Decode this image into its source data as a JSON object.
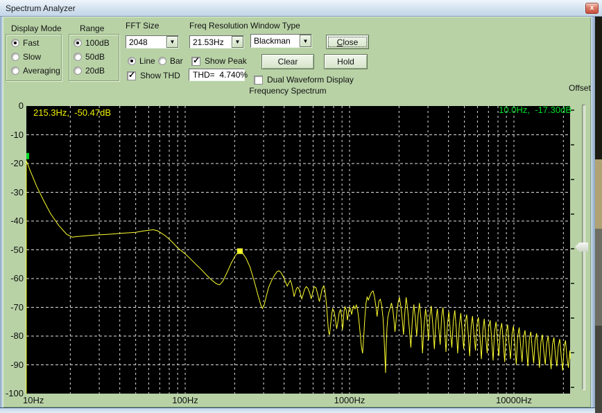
{
  "window": {
    "title": "Spectrum Analyzer",
    "close_glyph": "x"
  },
  "panel": {
    "display_mode": {
      "label": "Display Mode",
      "options": [
        {
          "label": "Fast",
          "selected": true
        },
        {
          "label": "Slow",
          "selected": false
        },
        {
          "label": "Averaging",
          "selected": false
        }
      ]
    },
    "range": {
      "label": "Range",
      "options": [
        {
          "label": "100dB",
          "selected": true
        },
        {
          "label": "50dB",
          "selected": false
        },
        {
          "label": "20dB",
          "selected": false
        }
      ]
    },
    "fft_size": {
      "label": "FFT Size",
      "value": "2048"
    },
    "freq_resolution": {
      "label": "Freq Resolution",
      "value": "21.53Hz"
    },
    "window_type": {
      "label": "Window Type",
      "value": "Blackman"
    },
    "line_bar": {
      "options": [
        {
          "label": "Line",
          "selected": true
        },
        {
          "label": "Bar",
          "selected": false
        }
      ]
    },
    "show_thd": {
      "label": "Show THD",
      "checked": true
    },
    "show_peak": {
      "label": "Show Peak",
      "checked": true
    },
    "thd_readout": "THD=  4.740%",
    "buttons": {
      "close": "Close",
      "clear": "Clear",
      "hold": "Hold"
    },
    "dual_waveform": {
      "label": "Dual Waveform Display",
      "checked": false
    },
    "offset_label": "Offset"
  },
  "chart_data": {
    "type": "line",
    "title": "Frequency Spectrum",
    "x_scale": "log",
    "x_range_hz": [
      10.8,
      22050
    ],
    "y_range_db": [
      -100,
      0
    ],
    "grid": true,
    "bg_color": "#000000",
    "grid_color": "#e2e2e2",
    "trace_color": "#ffff2e",
    "peak_marker_color": "#ffff2e",
    "cursor_marker_color": "#00dc28",
    "y_tick_labels": [
      "0",
      "-10",
      "-20",
      "-30",
      "-40",
      "-50",
      "-60",
      "-70",
      "-80",
      "-90",
      "-100"
    ],
    "x_ticks": [
      {
        "hz": 10,
        "label": "10Hz"
      },
      {
        "hz": 100,
        "label": "100Hz"
      },
      {
        "hz": 1000,
        "label": "1000Hz"
      },
      {
        "hz": 10000,
        "label": "10000Hz"
      }
    ],
    "peak_readout": "215.3Hz,  -50.47dB",
    "cursor_readout": "10.0Hz,  -17.30dB",
    "peak_marker": {
      "hz": 215.3,
      "db": -50.47
    },
    "cursor_marker": {
      "hz": 10.8,
      "db": -17.3
    },
    "points": [
      [
        10.8,
        -100
      ],
      [
        10.8,
        -19
      ],
      [
        11.5,
        -23
      ],
      [
        12.5,
        -28
      ],
      [
        13.8,
        -33
      ],
      [
        15.2,
        -37.5
      ],
      [
        17,
        -41.5
      ],
      [
        19,
        -44.6
      ],
      [
        20.5,
        -45.6
      ],
      [
        22,
        -45.4
      ],
      [
        25,
        -45.1
      ],
      [
        28,
        -44.9
      ],
      [
        32,
        -44.7
      ],
      [
        36,
        -44.5
      ],
      [
        40,
        -44.3
      ],
      [
        45,
        -44.1
      ],
      [
        50,
        -43.9
      ],
      [
        55,
        -43.5
      ],
      [
        60,
        -43.2
      ],
      [
        64,
        -43
      ],
      [
        68,
        -43.4
      ],
      [
        72,
        -44.3
      ],
      [
        76,
        -45.2
      ],
      [
        80,
        -46.3
      ],
      [
        85,
        -47.8
      ],
      [
        90,
        -49.3
      ],
      [
        95,
        -50.4
      ],
      [
        100,
        -51.4
      ],
      [
        108,
        -53.2
      ],
      [
        116,
        -55
      ],
      [
        125,
        -56.8
      ],
      [
        135,
        -58.8
      ],
      [
        145,
        -60.5
      ],
      [
        155,
        -61.8
      ],
      [
        162,
        -62.2
      ],
      [
        170,
        -60.8
      ],
      [
        180,
        -57.8
      ],
      [
        190,
        -54.8
      ],
      [
        200,
        -52.4
      ],
      [
        208,
        -51.1
      ],
      [
        215.3,
        -50.47
      ],
      [
        224,
        -51.2
      ],
      [
        235,
        -53
      ],
      [
        248,
        -56
      ],
      [
        262,
        -60.5
      ],
      [
        275,
        -65
      ],
      [
        288,
        -69
      ],
      [
        295,
        -70.4
      ],
      [
        302,
        -69.2
      ],
      [
        312,
        -66
      ],
      [
        322,
        -63
      ],
      [
        335,
        -60.8
      ],
      [
        350,
        -58.8
      ],
      [
        362,
        -57.6
      ],
      [
        372,
        -57.3
      ],
      [
        382,
        -57.8
      ],
      [
        395,
        -59.3
      ],
      [
        408,
        -61.2
      ],
      [
        418,
        -62.6
      ],
      [
        428,
        -61.4
      ],
      [
        436,
        -60.6
      ],
      [
        444,
        -61.8
      ],
      [
        452,
        -64
      ],
      [
        460,
        -66.3
      ],
      [
        468,
        -64.8
      ],
      [
        476,
        -63.4
      ],
      [
        484,
        -63
      ],
      [
        492,
        -63.6
      ],
      [
        502,
        -65.2
      ],
      [
        512,
        -67
      ],
      [
        522,
        -65.5
      ],
      [
        532,
        -63.8
      ],
      [
        545,
        -62.8
      ],
      [
        558,
        -63.4
      ],
      [
        572,
        -65
      ],
      [
        585,
        -67
      ],
      [
        598,
        -64.5
      ],
      [
        610,
        -62.8
      ],
      [
        625,
        -63.2
      ],
      [
        640,
        -65.5
      ],
      [
        655,
        -68
      ],
      [
        668,
        -66
      ],
      [
        680,
        -63.8
      ],
      [
        695,
        -62.6
      ],
      [
        705,
        -63.5
      ],
      [
        715,
        -66
      ],
      [
        725,
        -69.5
      ],
      [
        735,
        -74
      ],
      [
        745,
        -78.5
      ],
      [
        755,
        -79.6
      ],
      [
        765,
        -76.5
      ],
      [
        778,
        -72.5
      ],
      [
        790,
        -70.5
      ],
      [
        805,
        -71.5
      ],
      [
        820,
        -74
      ],
      [
        835,
        -77.5
      ],
      [
        850,
        -75
      ],
      [
        865,
        -71.8
      ],
      [
        880,
        -70.8
      ],
      [
        895,
        -73
      ],
      [
        905,
        -77.8
      ],
      [
        915,
        -75.5
      ],
      [
        925,
        -71.5
      ],
      [
        940,
        -69.8
      ],
      [
        955,
        -71
      ],
      [
        970,
        -74.5
      ],
      [
        985,
        -72
      ],
      [
        1000,
        -70
      ],
      [
        1015,
        -70.5
      ],
      [
        1030,
        -72.5
      ],
      [
        1045,
        -70.8
      ],
      [
        1060,
        -69.5
      ],
      [
        1080,
        -70.5
      ],
      [
        1100,
        -69.2
      ],
      [
        1120,
        -71
      ],
      [
        1140,
        -74.5
      ],
      [
        1160,
        -79
      ],
      [
        1180,
        -83.5
      ],
      [
        1200,
        -86
      ],
      [
        1220,
        -80
      ],
      [
        1240,
        -73.5
      ],
      [
        1260,
        -68.5
      ],
      [
        1280,
        -66.3
      ],
      [
        1300,
        -67.5
      ],
      [
        1330,
        -66
      ],
      [
        1360,
        -64.8
      ],
      [
        1390,
        -64.3
      ],
      [
        1420,
        -66.5
      ],
      [
        1450,
        -70
      ],
      [
        1470,
        -73.2
      ],
      [
        1490,
        -70.5
      ],
      [
        1510,
        -67.8
      ],
      [
        1540,
        -67.2
      ],
      [
        1570,
        -69.5
      ],
      [
        1600,
        -74
      ],
      [
        1620,
        -80
      ],
      [
        1640,
        -87
      ],
      [
        1655,
        -92.8
      ],
      [
        1670,
        -84
      ],
      [
        1690,
        -77
      ],
      [
        1710,
        -73.5
      ],
      [
        1740,
        -71.5
      ],
      [
        1770,
        -70
      ],
      [
        1800,
        -68.5
      ],
      [
        1830,
        -70.5
      ],
      [
        1860,
        -74
      ],
      [
        1890,
        -78.5
      ],
      [
        1920,
        -74.5
      ],
      [
        1950,
        -70.5
      ],
      [
        1980,
        -68
      ],
      [
        2010,
        -66.5
      ],
      [
        2050,
        -69.5
      ],
      [
        2090,
        -74
      ],
      [
        2130,
        -79.5
      ],
      [
        2170,
        -72
      ],
      [
        2210,
        -66.5
      ],
      [
        2260,
        -71
      ],
      [
        2310,
        -77.5
      ],
      [
        2360,
        -84
      ],
      [
        2410,
        -74.5
      ],
      [
        2460,
        -69
      ],
      [
        2510,
        -73.5
      ],
      [
        2560,
        -80
      ],
      [
        2610,
        -73
      ],
      [
        2660,
        -68.5
      ],
      [
        2720,
        -74
      ],
      [
        2780,
        -86
      ],
      [
        2840,
        -76.5
      ],
      [
        2900,
        -70.5
      ],
      [
        2960,
        -75
      ],
      [
        3020,
        -81.5
      ],
      [
        3080,
        -73
      ],
      [
        3140,
        -69.5
      ],
      [
        3210,
        -76
      ],
      [
        3280,
        -84.5
      ],
      [
        3350,
        -75
      ],
      [
        3420,
        -70.5
      ],
      [
        3490,
        -77
      ],
      [
        3560,
        -83
      ],
      [
        3630,
        -73.5
      ],
      [
        3700,
        -70
      ],
      [
        3780,
        -76.5
      ],
      [
        3860,
        -85.5
      ],
      [
        3940,
        -76
      ],
      [
        4020,
        -71.5
      ],
      [
        4100,
        -78
      ],
      [
        4190,
        -84
      ],
      [
        4280,
        -74.5
      ],
      [
        4370,
        -71
      ],
      [
        4460,
        -77.5
      ],
      [
        4550,
        -86
      ],
      [
        4650,
        -76.5
      ],
      [
        4750,
        -72
      ],
      [
        4850,
        -78.5
      ],
      [
        4950,
        -84.5
      ],
      [
        5050,
        -75.5
      ],
      [
        5160,
        -72.5
      ],
      [
        5270,
        -79
      ],
      [
        5380,
        -87
      ],
      [
        5490,
        -77
      ],
      [
        5600,
        -73
      ],
      [
        5720,
        -79.5
      ],
      [
        5840,
        -85
      ],
      [
        5960,
        -76
      ],
      [
        6080,
        -73.5
      ],
      [
        6210,
        -80
      ],
      [
        6340,
        -88
      ],
      [
        6470,
        -78
      ],
      [
        6600,
        -74
      ],
      [
        6740,
        -80.5
      ],
      [
        6880,
        -86
      ],
      [
        7020,
        -77
      ],
      [
        7170,
        -74.5
      ],
      [
        7320,
        -81
      ],
      [
        7470,
        -88.5
      ],
      [
        7620,
        -78.5
      ],
      [
        7780,
        -75
      ],
      [
        7940,
        -81.5
      ],
      [
        8100,
        -87
      ],
      [
        8270,
        -78
      ],
      [
        8440,
        -75.5
      ],
      [
        8610,
        -82
      ],
      [
        8790,
        -89
      ],
      [
        8970,
        -79
      ],
      [
        9150,
        -76
      ],
      [
        9340,
        -82.5
      ],
      [
        9530,
        -88
      ],
      [
        9730,
        -79.5
      ],
      [
        9930,
        -76.5
      ],
      [
        10130,
        -83
      ],
      [
        10340,
        -90
      ],
      [
        10550,
        -80
      ],
      [
        10770,
        -77
      ],
      [
        10990,
        -83.5
      ],
      [
        11210,
        -89
      ],
      [
        11440,
        -80.5
      ],
      [
        11680,
        -78
      ],
      [
        11920,
        -84
      ],
      [
        12160,
        -90.5
      ],
      [
        12410,
        -81
      ],
      [
        12670,
        -78.5
      ],
      [
        12930,
        -84.5
      ],
      [
        13190,
        -89.5
      ],
      [
        13460,
        -81.5
      ],
      [
        13740,
        -79
      ],
      [
        14020,
        -85
      ],
      [
        14310,
        -91
      ],
      [
        14600,
        -82
      ],
      [
        14900,
        -79.5
      ],
      [
        15210,
        -85.5
      ],
      [
        15520,
        -90
      ],
      [
        15840,
        -82.5
      ],
      [
        16160,
        -80
      ],
      [
        16490,
        -86
      ],
      [
        16830,
        -91.5
      ],
      [
        17170,
        -83
      ],
      [
        17520,
        -80.5
      ],
      [
        17880,
        -86.5
      ],
      [
        18250,
        -90.5
      ],
      [
        18620,
        -83.5
      ],
      [
        19000,
        -81
      ],
      [
        19390,
        -87
      ],
      [
        19790,
        -92
      ],
      [
        20190,
        -84
      ],
      [
        20610,
        -81.5
      ],
      [
        21030,
        -87.5
      ],
      [
        21460,
        -91
      ],
      [
        21900,
        -85
      ],
      [
        22050,
        -88
      ]
    ]
  }
}
